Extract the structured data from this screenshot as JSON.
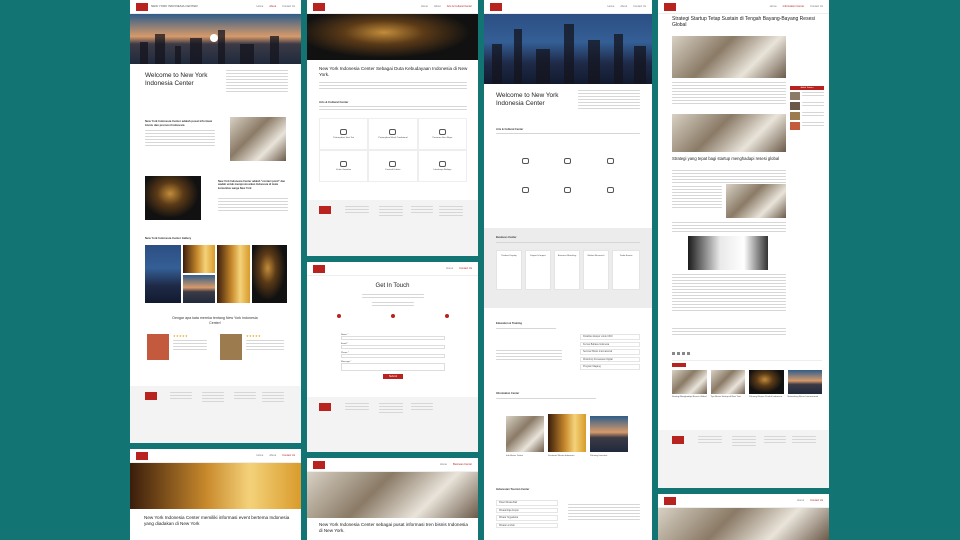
{
  "brand": {
    "logo_text": "NEW YORK INDONESIA CENTER",
    "accent": "#b8231f",
    "background": "#127574"
  },
  "nav": {
    "items": [
      "Home",
      "About",
      "Arts & Cultural Center",
      "Business Center",
      "Information Center",
      "Education & Training",
      "Indonesian Tourism Center",
      "Tour",
      "Contact Us"
    ],
    "cta": "Get In Touch"
  },
  "page1": {
    "title": "Welcome to New York Indonesia Center",
    "section_gallery": "New York Indonesia Center Gallery",
    "testimonial_title": "Dengar apa kata mereka tentang New York Indonesia Center!",
    "feature1_title": "New York Indonesia Center adalah pusat informasi bisnis dan promosi Indonesia",
    "feature2_title": "New York Indonesia Center adalah \"contact point\" dan wadah untuk mempromosikan Indonesia di mata komunitas warga New York",
    "stars": "★★★★★"
  },
  "page2": {
    "title": "New York Indonesia Center Sebagai Duta Kebudayaan Indonesia di New York.",
    "section": "Arts & Cultural Center",
    "services": [
      "Pertunjukan Seni Tari",
      "Pertunjukan Musik Tradisional",
      "Pameran Seni Rupa",
      "Kelas Gamelan",
      "Festival Kuliner",
      "Lokakarya Budaya"
    ]
  },
  "page3": {
    "title": "Get In Touch",
    "submit": "Submit",
    "fields": [
      "Name *",
      "Email *",
      "Phone *",
      "Message *"
    ]
  },
  "page4": {
    "title": "New York Indonesia Center sebagai pusat informasi tren bisnis Indonesia di New York."
  },
  "page5": {
    "title": "Welcome to New York Indonesia Center",
    "section_arts": "Arts & Cultural Center",
    "section_business": "Business Center",
    "business_cards": [
      "Product Display",
      "Export & Import",
      "Business Matching",
      "Market Research",
      "Trade Events"
    ],
    "section_edu": "Education & Training",
    "edu_items": [
      "Pelatihan Ekspor untuk UKM",
      "Kursus Bahasa Indonesia",
      "Seminar Bisnis Internasional",
      "Workshop Pemasaran Digital",
      "Program Magang"
    ],
    "section_info": "Information Center",
    "info_captions": [
      "Info Bisnis Terkini",
      "Destinasi Wisata Indonesia",
      "Peluang Investasi"
    ],
    "section_tour": "Indonesian Tourism Center",
    "tour_items": [
      "Paket Wisata Bali",
      "Wisata Raja Ampat",
      "Wisata Yogyakarta",
      "Wisata Lombok"
    ]
  },
  "page6": {
    "title": "Strategi Startup Tetap Sustain di Tengah Bayang-Bayang Resesi Global",
    "subtitle": "Strategi yang tepat bagi startup menghadapi resesi global",
    "sidebar_heading": "Artikel Terbaru",
    "related": [
      "Strategi Menghadapi Resesi Global",
      "Tips Bisnis Startup di New York",
      "Peluang Ekspor Produk Indonesia",
      "Networking Bisnis Internasional"
    ]
  },
  "page7": {
    "title": "New York Indonesia Center memiliki informasi event bertema Indonesia yang diadakan di New York"
  }
}
